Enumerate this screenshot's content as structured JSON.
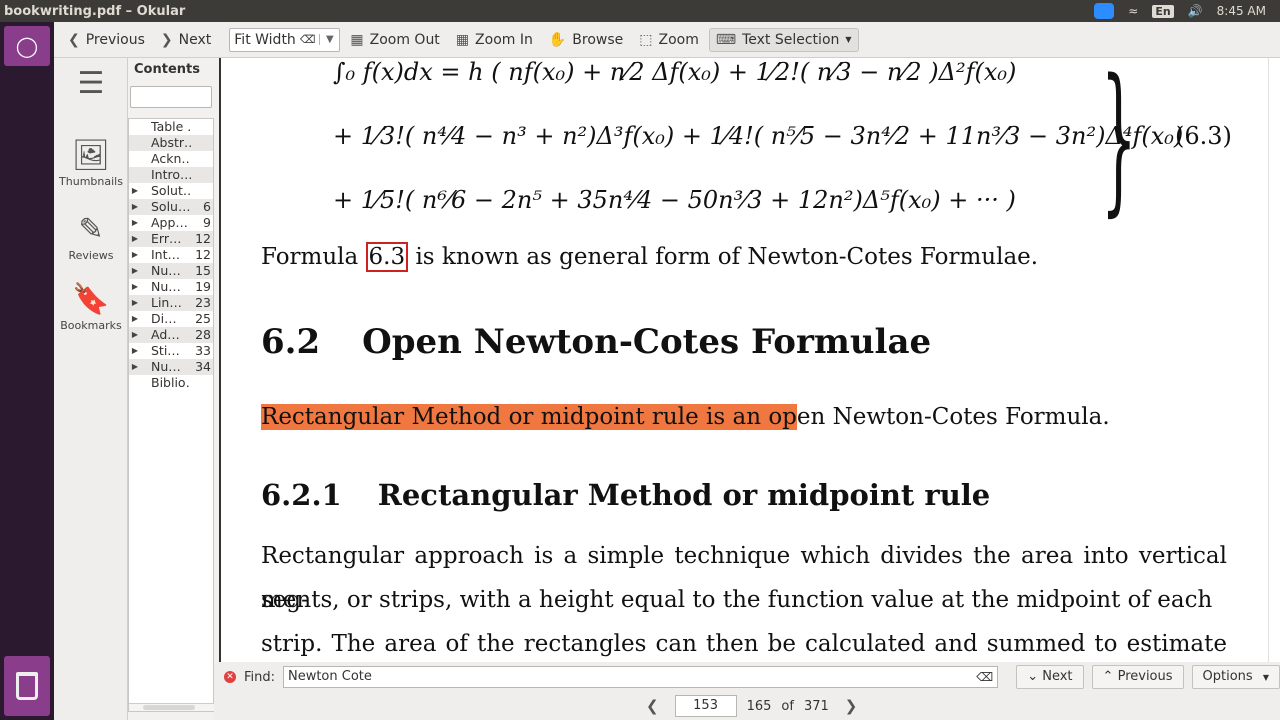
{
  "window": {
    "title": "bookwriting.pdf – Okular"
  },
  "tray": {
    "lang": "En",
    "time": "8:45 AM"
  },
  "toolbar": {
    "previous": "Previous",
    "next": "Next",
    "fit_width": "Fit Width",
    "zoom_out": "Zoom Out",
    "zoom_in": "Zoom In",
    "browse": "Browse",
    "zoom": "Zoom",
    "text_selection": "Text Selection"
  },
  "sidebar": {
    "thumbnails": "Thumbnails",
    "reviews": "Reviews",
    "bookmarks": "Bookmarks"
  },
  "contents": {
    "header": "Contents",
    "items": [
      {
        "label": "Table …",
        "page": "",
        "expand": false
      },
      {
        "label": "Abstr…",
        "page": "",
        "expand": false
      },
      {
        "label": "Ackn…",
        "page": "",
        "expand": false
      },
      {
        "label": "Intro…",
        "page": "",
        "expand": false
      },
      {
        "label": "Solut…",
        "page": "",
        "expand": true
      },
      {
        "label": "Solu…",
        "page": "6",
        "expand": true
      },
      {
        "label": "App…",
        "page": "9",
        "expand": true
      },
      {
        "label": "Err…",
        "page": "12",
        "expand": true
      },
      {
        "label": "Int…",
        "page": "12",
        "expand": true
      },
      {
        "label": "Nu…",
        "page": "15",
        "expand": true
      },
      {
        "label": "Nu…",
        "page": "19",
        "expand": true
      },
      {
        "label": "Lin…",
        "page": "23",
        "expand": true
      },
      {
        "label": "Di…",
        "page": "25",
        "expand": true
      },
      {
        "label": "Ad…",
        "page": "28",
        "expand": true
      },
      {
        "label": "Sti…",
        "page": "33",
        "expand": true
      },
      {
        "label": "Nu…",
        "page": "34",
        "expand": true
      },
      {
        "label": "Biblio…",
        "page": "",
        "expand": false
      }
    ]
  },
  "document": {
    "eq_line1": "∫₀  f(x)dx = h ( nf(x₀) + n⁄2 Δf(x₀) + 1⁄2!( n⁄3 − n⁄2 )Δ²f(x₀)",
    "eq_line2": "+ 1⁄3!( n⁴⁄4 − n³ + n²)Δ³f(x₀) + 1⁄4!( n⁵⁄5 − 3n⁴⁄2 + 11n³⁄3 − 3n²)Δ⁴f(x₀)",
    "eq_line3": "+ 1⁄5!( n⁶⁄6 − 2n⁵ + 35n⁴⁄4 − 50n³⁄3 + 12n²)Δ⁵f(x₀) + ··· )",
    "eq_number": "(6.3)",
    "formula_prefix": "Formula",
    "formula_ref": "6.3",
    "formula_suffix": "is known as general form of Newton-Cotes Formulae.",
    "section_number": "6.2",
    "section_title": "Open Newton-Cotes Formulae",
    "intro_highlighted": "Rectangular Method or midpoint rule is an op",
    "intro_rest": "en Newton-Cotes Formula.",
    "subsection_number": "6.2.1",
    "subsection_title": "Rectangular Method or midpoint rule",
    "body_line1": "Rectangular approach is a simple technique which divides the area into vertical seg-",
    "body_line2": "ments, or strips, with a height equal to the function value at the midpoint of each",
    "body_line3": "strip. The area of the rectangles can then be calculated and summed to estimate the"
  },
  "findbar": {
    "label": "Find:",
    "value": "Newton Cote",
    "next": "Next",
    "previous": "Previous",
    "options": "Options"
  },
  "pagebar": {
    "current": "153",
    "page_label": "165",
    "of": "of",
    "total": "371"
  }
}
